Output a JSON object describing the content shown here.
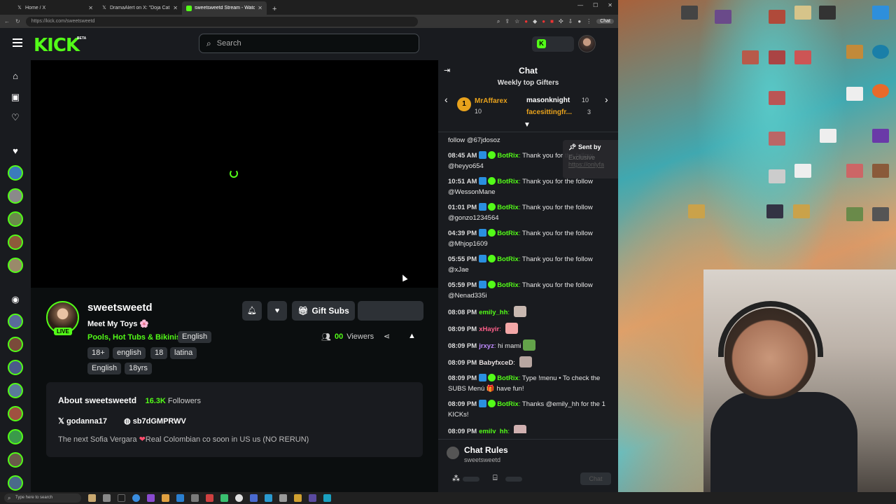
{
  "browser": {
    "tabs": [
      {
        "title": "Home / X",
        "icon": "x-logo-icon"
      },
      {
        "title": "DramaAlert on X: \"Doja Cat reveal...",
        "icon": "x-logo-icon"
      },
      {
        "title": "sweetsweetd Stream - Watch Live...",
        "icon": "kick-logo-icon"
      }
    ],
    "url": "https://kick.com/sweetsweetd",
    "chat_extension_label": "Chat"
  },
  "header": {
    "logo": "KICK",
    "logo_badge": "BETA",
    "search_placeholder": "Search"
  },
  "streamer": {
    "name": "sweetsweetd",
    "live_label": "LIVE",
    "title": "Meet My Toys",
    "title_emoji": "🌸",
    "category": "Pools, Hot Tubs & Bikinis",
    "language_chip": "English",
    "tags": [
      "18+",
      "english",
      "18",
      "latina",
      "English",
      "18yrs"
    ],
    "gift_subs_label": "Gift Subs",
    "viewers_count": "00",
    "viewers_label": "Viewers"
  },
  "about": {
    "title": "About sweetsweetd",
    "followers_count": "16.3K",
    "followers_label": "Followers",
    "twitter": "godanna17",
    "discord": "sb7dGMPRWV",
    "bio_part1": "The next Sofia Vergara ",
    "bio_heart": "❤",
    "bio_part2": "Real Colombian co soon in US us (NO RERUN)"
  },
  "chat": {
    "title": "Chat",
    "gifters_title": "Weekly top Gifters",
    "gifters": [
      {
        "rank": "1",
        "name": "MrAffarex",
        "count": "10"
      },
      {
        "name": "masonknight",
        "count": "10"
      },
      {
        "name": "facesittingfr...",
        "count": "3"
      }
    ],
    "first_line": "follow @67jdosoz",
    "messages": [
      {
        "time": "08:45 AM",
        "user": "BotRix",
        "text": "Thank you for the follow @heyyo654",
        "color": "#53fc18",
        "bot": true
      },
      {
        "time": "10:51 AM",
        "user": "BotRix",
        "text": "Thank you for the follow @WessonMane",
        "color": "#53fc18",
        "bot": true
      },
      {
        "time": "01:01 PM",
        "user": "BotRix",
        "text": "Thank you for the follow @gonzo1234564",
        "color": "#53fc18",
        "bot": true
      },
      {
        "time": "04:39 PM",
        "user": "BotRix",
        "text": "Thank you for the follow @Mhjop1609",
        "color": "#53fc18",
        "bot": true
      },
      {
        "time": "05:55 PM",
        "user": "BotRix",
        "text": "Thank you for the follow @xJae",
        "color": "#53fc18",
        "bot": true
      },
      {
        "time": "05:59 PM",
        "user": "BotRix",
        "text": "Thank you for the follow @Nenad335i",
        "color": "#53fc18",
        "bot": true
      },
      {
        "time": "08:08 PM",
        "user": "emily_hh",
        "text": "",
        "color": "#53fc18",
        "bot": false,
        "emote": "#c8b8b0"
      },
      {
        "time": "08:09 PM",
        "user": "xHayir",
        "text": "",
        "color": "#ff5f8a",
        "bot": false,
        "emote": "#f3a7a7"
      },
      {
        "time": "08:09 PM",
        "user": "jrxyz",
        "text": "hi mami",
        "color": "#c08cff",
        "bot": false,
        "emote": "#63a34a"
      },
      {
        "time": "08:09 PM",
        "user": "BabyfxceD",
        "text": "",
        "color": "#e8e0e0",
        "bot": false,
        "emote": "#b7a6a0"
      },
      {
        "time": "08:09 PM",
        "user": "BotRix",
        "text": "Type !menu • To check the SUBS Menú 🎁 have fun!",
        "color": "#53fc18",
        "bot": true
      },
      {
        "time": "08:09 PM",
        "user": "BotRix",
        "text": "Thanks @emily_hh for the 1 KICKs!",
        "color": "#53fc18",
        "bot": true
      },
      {
        "time": "08:09 PM",
        "user": "emily_hh",
        "text": "",
        "color": "#53fc18",
        "bot": false,
        "emote": "#d0b0b0"
      }
    ],
    "pinned_sent_by": "Sent by",
    "pinned_faded": "Exclusive",
    "pinned_link": "https://onlyfa",
    "rules_title": "Chat Rules",
    "rules_subtitle": "sweetsweetd",
    "send_label": "Chat"
  },
  "taskbar": {
    "search_placeholder": "Type here to search"
  },
  "colors": {
    "accent": "#53fc18",
    "panel": "#191b1f",
    "background": "#0b0e0f"
  }
}
